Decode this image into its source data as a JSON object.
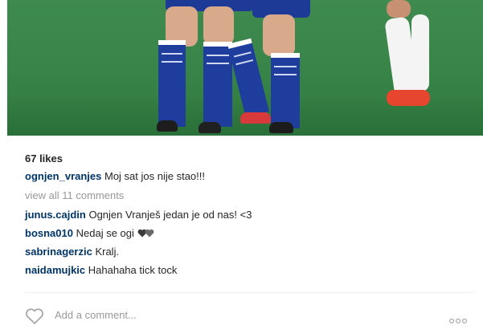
{
  "post": {
    "likes_text": "67 likes",
    "caption": {
      "username": "ognjen_vranjes",
      "text": "Moj sat jos nije stao!!!"
    },
    "view_all_comments": "view all 11 comments",
    "comments": [
      {
        "username": "junus.cajdin",
        "text": "Ognjen Vranješ jedan je od nas! <3"
      },
      {
        "username": "bosna010",
        "text": "Nedaj se ogi"
      },
      {
        "username": "sabrinagerzic",
        "text": "Kralj."
      },
      {
        "username": "naidamujkic",
        "text": "Hahahaha tick tock"
      }
    ],
    "comment_hearts_icon": "two-hearts-icon",
    "add_comment_placeholder": "Add a comment...",
    "like_icon": "heart-outline-icon",
    "more_icon": "more-options-icon"
  },
  "colors": {
    "username": "#003569",
    "muted": "#999999",
    "text": "#262626",
    "pitch": "#3a8549",
    "kit_blue": "#1f3d9c"
  }
}
